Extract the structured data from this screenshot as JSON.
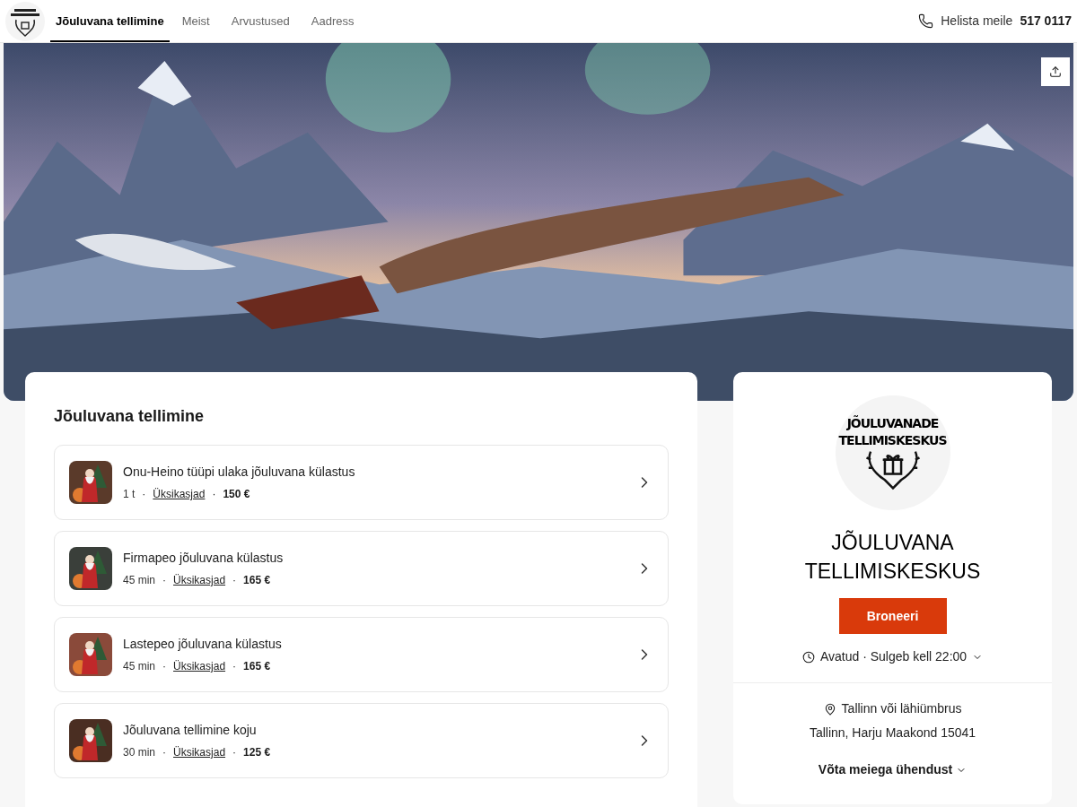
{
  "header": {
    "tabs": [
      {
        "label": "Jõuluvana tellimine",
        "selected": true
      },
      {
        "label": "Meist",
        "selected": false
      },
      {
        "label": "Arvustused",
        "selected": false
      },
      {
        "label": "Aadress",
        "selected": false
      }
    ],
    "phone_label": "Helista meile",
    "phone": "517 0117"
  },
  "services": {
    "title": "Jõuluvana tellimine",
    "items": [
      {
        "name": "Onu-Heino tüüpi ulaka jõuluvana külastus",
        "duration": "1 t",
        "separators": [
          "·",
          "·"
        ],
        "details": "Üksikasjad",
        "price": "150 €"
      },
      {
        "name": "Firmapeo jõuluvana külastus",
        "duration": "45 min",
        "separators": [
          "·",
          "·"
        ],
        "details": "Üksikasjad",
        "price": "165 €"
      },
      {
        "name": "Lastepeo jõuluvana külastus",
        "duration": "45 min",
        "separators": [
          "·",
          "·"
        ],
        "details": "Üksikasjad",
        "price": "165 €"
      },
      {
        "name": "Jõuluvana tellimine koju",
        "duration": "30 min",
        "separators": [
          "·",
          "·"
        ],
        "details": "Üksikasjad",
        "price": "125 €"
      }
    ]
  },
  "business": {
    "logo_lines": [
      "JÕULUVANADE",
      "TELLIMISKESKUS"
    ],
    "name_lines": [
      "JÕULUVANA",
      "TELLIMISKESKUS"
    ],
    "book_button": "Broneeri",
    "hours": "Avatud · Sulgeb kell 22:00",
    "location": "Tallinn või lähiümbrus",
    "address": "Tallinn, Harju Maakond 15041",
    "contact": "Võta meiega ühendust"
  }
}
